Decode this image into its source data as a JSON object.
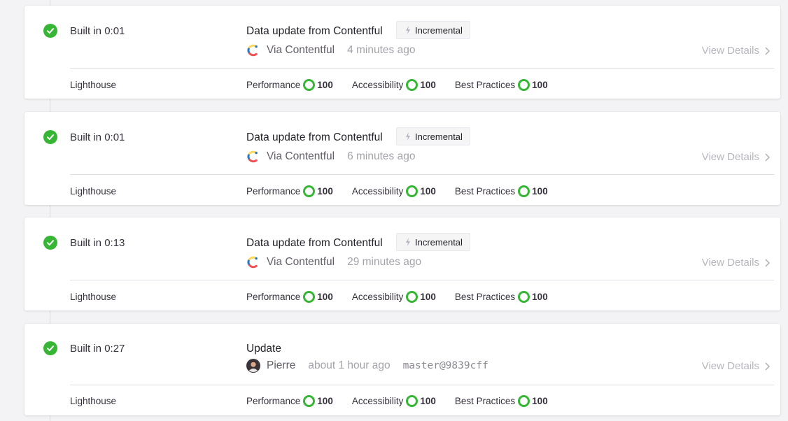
{
  "colors": {
    "success": "#37b635",
    "background": "#f3f3f5",
    "card": "#ffffff"
  },
  "builds": [
    {
      "built_in": "Built in 0:01",
      "title": "Data update from Contentful",
      "badge": "Incremental",
      "source_icon": "contentful-logo-icon",
      "source": "Via Contentful",
      "time_ago": "4 minutes ago",
      "commit": "",
      "view_details": "View Details",
      "lighthouse_label": "Lighthouse",
      "scores": [
        {
          "label": "Performance",
          "value": "100"
        },
        {
          "label": "Accessibility",
          "value": "100"
        },
        {
          "label": "Best Practices",
          "value": "100"
        }
      ]
    },
    {
      "built_in": "Built in 0:01",
      "title": "Data update from Contentful",
      "badge": "Incremental",
      "source_icon": "contentful-logo-icon",
      "source": "Via Contentful",
      "time_ago": "6 minutes ago",
      "commit": "",
      "view_details": "View Details",
      "lighthouse_label": "Lighthouse",
      "scores": [
        {
          "label": "Performance",
          "value": "100"
        },
        {
          "label": "Accessibility",
          "value": "100"
        },
        {
          "label": "Best Practices",
          "value": "100"
        }
      ]
    },
    {
      "built_in": "Built in 0:13",
      "title": "Data update from Contentful",
      "badge": "Incremental",
      "source_icon": "contentful-logo-icon",
      "source": "Via Contentful",
      "time_ago": "29 minutes ago",
      "commit": "",
      "view_details": "View Details",
      "lighthouse_label": "Lighthouse",
      "scores": [
        {
          "label": "Performance",
          "value": "100"
        },
        {
          "label": "Accessibility",
          "value": "100"
        },
        {
          "label": "Best Practices",
          "value": "100"
        }
      ]
    },
    {
      "built_in": "Built in 0:27",
      "title": "Update",
      "badge": "",
      "source_icon": "user-avatar-icon",
      "source": "Pierre",
      "time_ago": "about 1 hour ago",
      "commit": "master@9839cff",
      "view_details": "View Details",
      "lighthouse_label": "Lighthouse",
      "scores": [
        {
          "label": "Performance",
          "value": "100"
        },
        {
          "label": "Accessibility",
          "value": "100"
        },
        {
          "label": "Best Practices",
          "value": "100"
        }
      ]
    }
  ]
}
